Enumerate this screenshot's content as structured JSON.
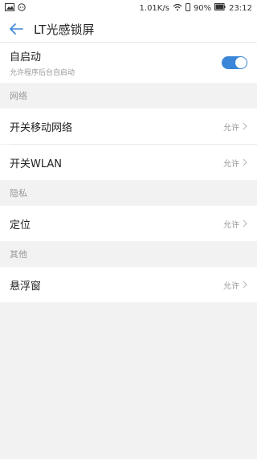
{
  "status": {
    "net_speed": "1.01K/s",
    "battery": "90%",
    "time": "23:12"
  },
  "header": {
    "title": "LT光感锁屏"
  },
  "autostart": {
    "label": "自启动",
    "subtitle": "允许程序后台自启动",
    "enabled": true
  },
  "sections": [
    {
      "header": "网络",
      "items": [
        {
          "label": "开关移动网络",
          "value": "允许"
        },
        {
          "label": "开关WLAN",
          "value": "允许"
        }
      ]
    },
    {
      "header": "隐私",
      "items": [
        {
          "label": "定位",
          "value": "允许"
        }
      ]
    },
    {
      "header": "其他",
      "items": [
        {
          "label": "悬浮窗",
          "value": "允许"
        }
      ]
    }
  ],
  "colors": {
    "accent": "#3b86d8"
  }
}
